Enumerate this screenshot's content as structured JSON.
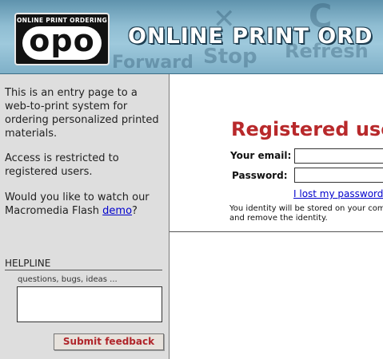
{
  "header": {
    "logo_top": "ONLINE PRINT ORDERING",
    "logo_word": "opo",
    "title": "ONLINE PRINT ORD",
    "ghost_buttons": [
      "Forward",
      "Stop",
      "Refresh"
    ]
  },
  "sidebar": {
    "intro_1": "This is an entry page to a",
    "intro_2": "web-to-print",
    "intro_3": " system for ordering personalized printed materials.",
    "access": "Access is restricted to registered users.",
    "watch": "Would you like to watch our Macromedia Flash ",
    "demo_link": "demo",
    "watch_end": "?",
    "helpline_title": "HELPLINE",
    "helpline_hint": "questions, bugs, ideas ...",
    "helpline_value": "",
    "submit_label": "Submit feedback"
  },
  "login": {
    "heading": "Registered users",
    "email_label": "Your email:",
    "email_value": "",
    "password_label": "Password:",
    "password_value": "",
    "lost_password": "I lost my password",
    "note_line1": "You identity will be stored on your compu",
    "note_line2": "and remove the identity."
  },
  "colors": {
    "accent_red": "#b8292b",
    "link_blue": "#0000cc",
    "sidebar_bg": "#dedede",
    "header_blue": "#8fbdd2"
  }
}
